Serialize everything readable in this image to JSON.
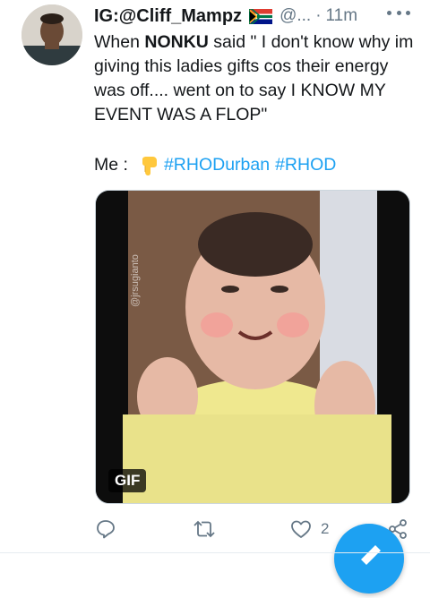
{
  "tweet": {
    "display_name": "IG:@Cliff_Mampz",
    "handle": "@...",
    "separator": "·",
    "time": "11m",
    "text_line1_pre": "When ",
    "text_bold": "NONKU",
    "text_line1_post": " said \" I don't know why im giving this ladies gifts cos their energy was off.... went on to say I KNOW MY EVENT WAS A FLOP\"",
    "me_label": "Me :",
    "hashtags": [
      "#RHODurban",
      "#RHOD"
    ]
  },
  "media": {
    "badge": "GIF",
    "watermark": "@jrsugianto"
  },
  "actions": {
    "like_count": "2"
  },
  "colors": {
    "link": "#1da1f2",
    "secondary_text": "#657786",
    "border": "#ccd6dd"
  },
  "icons": {
    "flag": "south-africa-flag-icon",
    "pointer": "backhand-index-pointing-down-icon",
    "reply": "reply-icon",
    "retweet": "retweet-icon",
    "like": "heart-icon",
    "share": "share-icon",
    "compose": "compose-tweet-icon"
  }
}
